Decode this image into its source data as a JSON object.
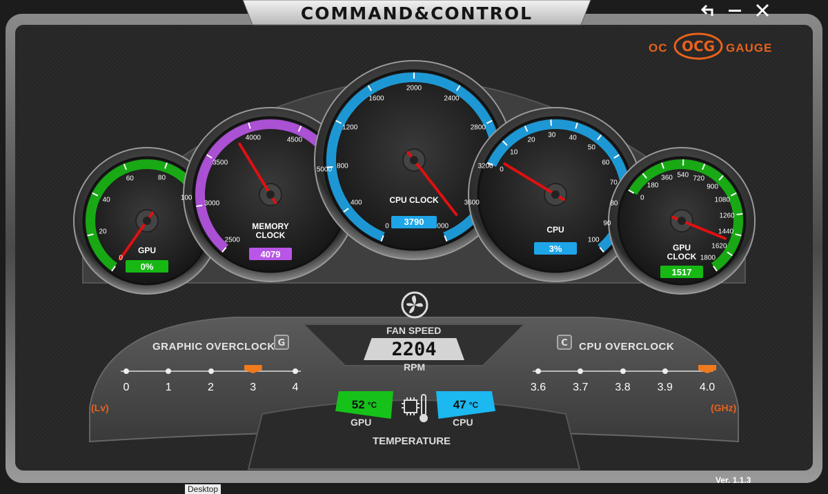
{
  "window": {
    "title": "COMMAND&CONTROL",
    "brand_left": "OC",
    "brand_mid": "OCG",
    "brand_right": "GAUGE",
    "version": "Ver. 1.1.3"
  },
  "gauges": {
    "gpu": {
      "label": "GPU",
      "value": "0%",
      "ticks": [
        "0",
        "20",
        "40",
        "60",
        "80",
        "100"
      ],
      "color": "#17b814"
    },
    "memory": {
      "label_1": "MEMORY",
      "label_2": "CLOCK",
      "value": "4079",
      "ticks": [
        "2500",
        "3000",
        "3500",
        "4000",
        "4500",
        "5000"
      ],
      "color": "#b956e8"
    },
    "cpu_clock": {
      "label": "CPU CLOCK",
      "value": "3790",
      "ticks": [
        "0",
        "400",
        "800",
        "1200",
        "1600",
        "2000",
        "2400",
        "2800",
        "3200",
        "3600",
        "4000"
      ],
      "color": "#1ea5e8"
    },
    "cpu": {
      "label": "CPU",
      "value": "3%",
      "ticks": [
        "0",
        "10",
        "20",
        "30",
        "40",
        "50",
        "60",
        "70",
        "80",
        "90",
        "100"
      ],
      "color": "#1ea5e8"
    },
    "gpu_clock": {
      "label_1": "GPU",
      "label_2": "CLOCK",
      "value": "1517",
      "ticks": [
        "0",
        "180",
        "360",
        "540",
        "720",
        "900",
        "1080",
        "1260",
        "1440",
        "1620",
        "1800"
      ],
      "color": "#17b814"
    }
  },
  "fan": {
    "label": "FAN SPEED",
    "value": "2204",
    "unit": "RPM"
  },
  "graphic_overclock": {
    "title": "GRAPHIC OVERCLOCK",
    "levels": [
      "0",
      "1",
      "2",
      "3",
      "4"
    ],
    "selected": "3",
    "unit": "(Lv)"
  },
  "cpu_overclock": {
    "title": "CPU OVERCLOCK",
    "levels": [
      "3.6",
      "3.7",
      "3.8",
      "3.9",
      "4.0"
    ],
    "selected": "4.0",
    "unit": "(GHz)"
  },
  "temperature": {
    "label": "TEMPERATURE",
    "gpu_value": "52",
    "cpu_value": "47",
    "unit": "°C",
    "gpu_label": "GPU",
    "cpu_label": "CPU",
    "gpu_color": "#16c21a",
    "cpu_color": "#1cb8f0"
  },
  "taskbar": {
    "item": "Desktop"
  },
  "icons": {
    "back": "back-arrow-icon",
    "minimize": "minimize-icon",
    "close": "close-icon",
    "fan": "fan-icon",
    "chip": "chip-icon",
    "thermometer": "thermometer-icon"
  }
}
